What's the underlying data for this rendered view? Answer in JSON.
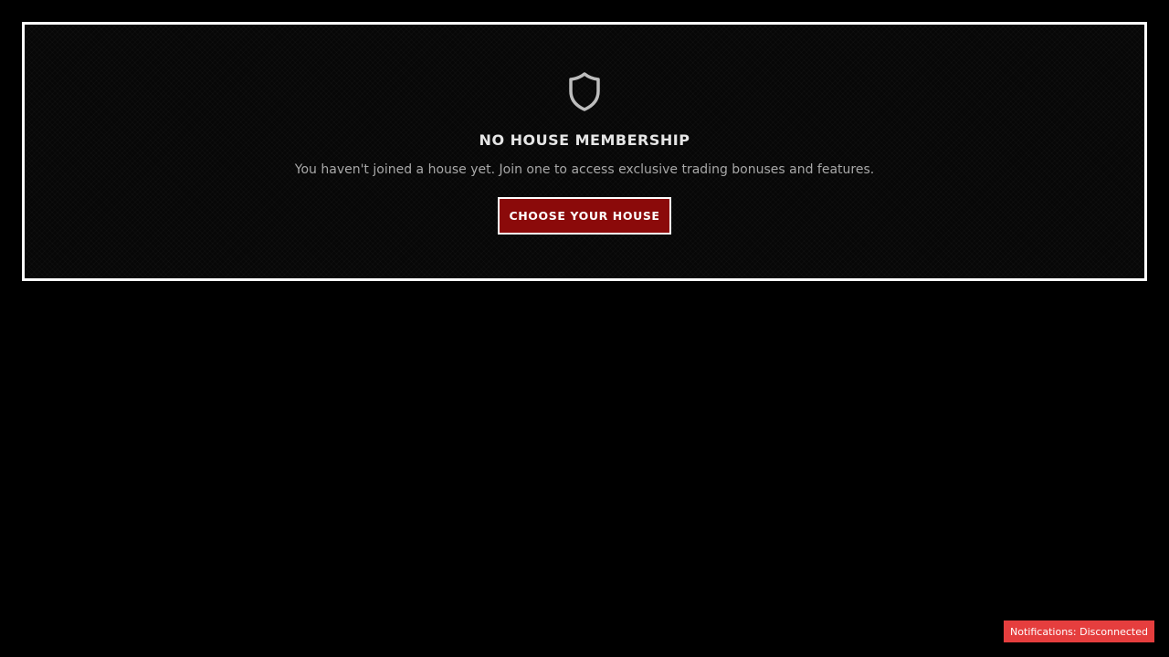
{
  "membership_card": {
    "icon": "shield-icon",
    "title": "NO HOUSE MEMBERSHIP",
    "description": "You haven't joined a house yet. Join one to access exclusive trading bonuses and features.",
    "cta_label": "CHOOSE YOUR HOUSE"
  },
  "notification_status": {
    "text": "Notifications: Disconnected",
    "color": "#e53e3e"
  },
  "colors": {
    "background": "#000000",
    "card_border": "#ffffff",
    "cta_background": "#8b0a0a",
    "title_text": "#e6e6e6",
    "description_text": "#a8a8a8"
  }
}
